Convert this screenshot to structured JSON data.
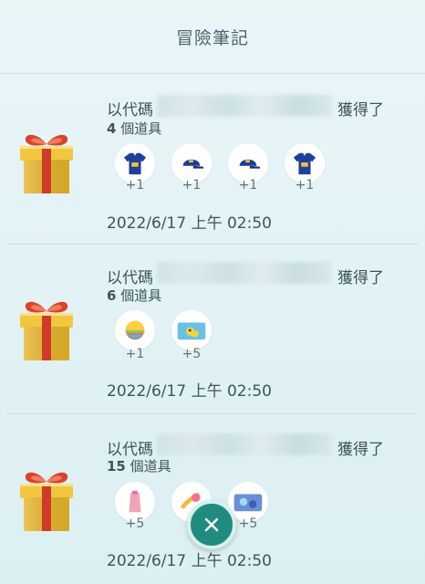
{
  "header": {
    "title": "冒險筆記"
  },
  "entries": [
    {
      "prefix": "以代碼",
      "suffix": "獲得了",
      "count_number": "4",
      "count_unit": " 個道具",
      "items": [
        {
          "icon": "blue-shirt-icon",
          "qty": "+1"
        },
        {
          "icon": "blue-cap-icon",
          "qty": "+1"
        },
        {
          "icon": "blue-cap-icon",
          "qty": "+1"
        },
        {
          "icon": "blue-shirt-icon",
          "qty": "+1"
        }
      ],
      "date": "2022/6/17 上午 02:50"
    },
    {
      "prefix": "以代碼",
      "suffix": "獲得了",
      "count_number": "6",
      "count_unit": " 個道具",
      "items": [
        {
          "icon": "rainbow-orb-icon",
          "qty": "+1"
        },
        {
          "icon": "pikachu-sticker-icon",
          "qty": "+5"
        }
      ],
      "date": "2022/6/17 上午 02:50"
    },
    {
      "prefix": "以代碼",
      "suffix": "獲得了",
      "count_number": "15",
      "count_unit": " 個道具",
      "items": [
        {
          "icon": "pink-sticker-icon",
          "qty": "+5"
        },
        {
          "icon": "star-sticker-icon",
          "qty": ""
        },
        {
          "icon": "blue-sticker-icon",
          "qty": "+5"
        }
      ],
      "date": "2022/6/17 上午 02:50"
    }
  ],
  "close_button": {
    "icon": "close-icon"
  }
}
